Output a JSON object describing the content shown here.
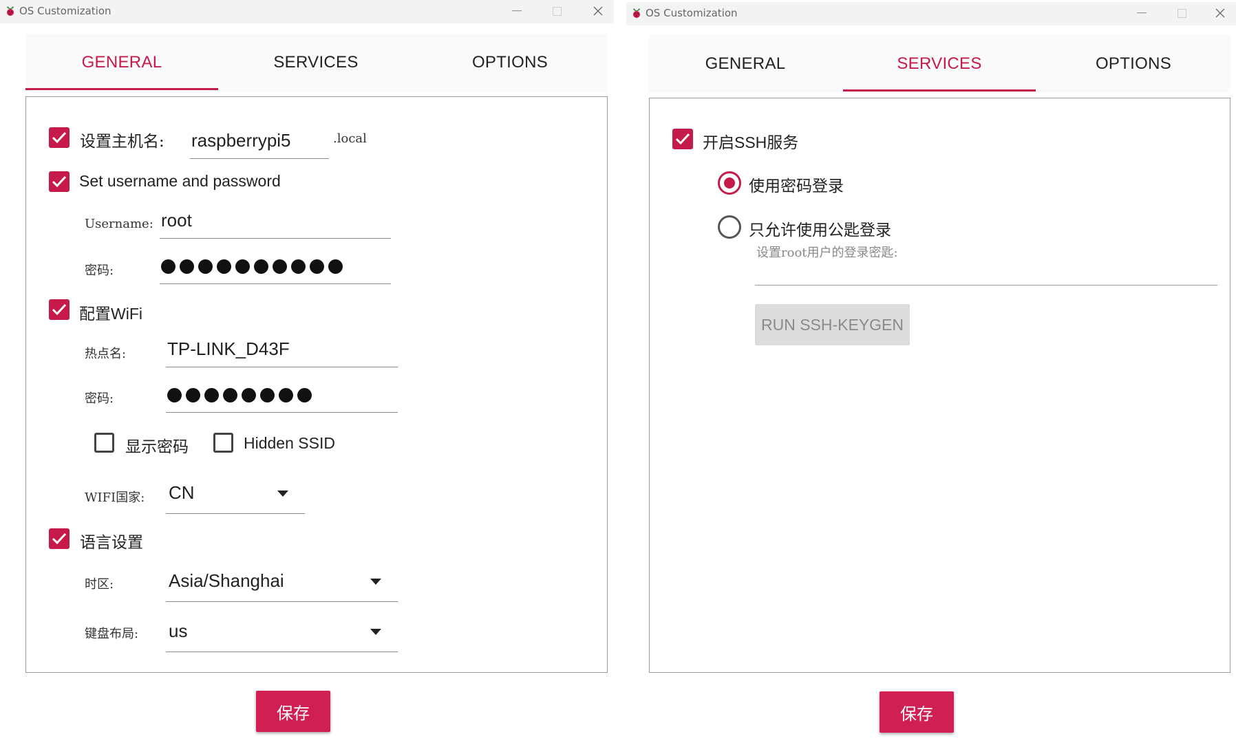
{
  "colors": {
    "accent": "#c51a4a",
    "save": "#cf1f53"
  },
  "left": {
    "title": "OS Customization",
    "tabs": [
      {
        "label": "GENERAL",
        "active": true
      },
      {
        "label": "SERVICES",
        "active": false
      },
      {
        "label": "OPTIONS",
        "active": false
      }
    ],
    "hostname": {
      "label": "设置主机名:",
      "value": "raspberrypi5",
      "suffix": ".local",
      "checked": true
    },
    "user": {
      "label": "Set username and password",
      "checked": true,
      "username_label": "Username:",
      "username": "root",
      "password_label": "密码:",
      "password_length": 10
    },
    "wifi": {
      "label": "配置WiFi",
      "checked": true,
      "ssid_label": "热点名:",
      "ssid": "TP-LINK_D43F",
      "password_label": "密码:",
      "password_length": 8,
      "show_password_label": "显示密码",
      "hidden_ssid_label": "Hidden SSID",
      "country_label": "WIFI国家:",
      "country": "CN"
    },
    "locale": {
      "label": "语言设置",
      "checked": true,
      "timezone_label": "时区:",
      "timezone": "Asia/Shanghai",
      "keyboard_label": "键盘布局:",
      "keyboard": "us"
    },
    "save_label": "保存"
  },
  "right": {
    "title": "OS Customization",
    "tabs": [
      {
        "label": "GENERAL",
        "active": false
      },
      {
        "label": "SERVICES",
        "active": true
      },
      {
        "label": "OPTIONS",
        "active": false
      }
    ],
    "ssh": {
      "label": "开启SSH服务",
      "checked": true,
      "password_auth_label": "使用密码登录",
      "pubkey_auth_label": "只允许使用公匙登录",
      "pubkey_hint": "设置root用户的登录密匙:",
      "pubkey_value": "",
      "keygen_label": "RUN SSH-KEYGEN",
      "selected": "password"
    },
    "save_label": "保存"
  }
}
